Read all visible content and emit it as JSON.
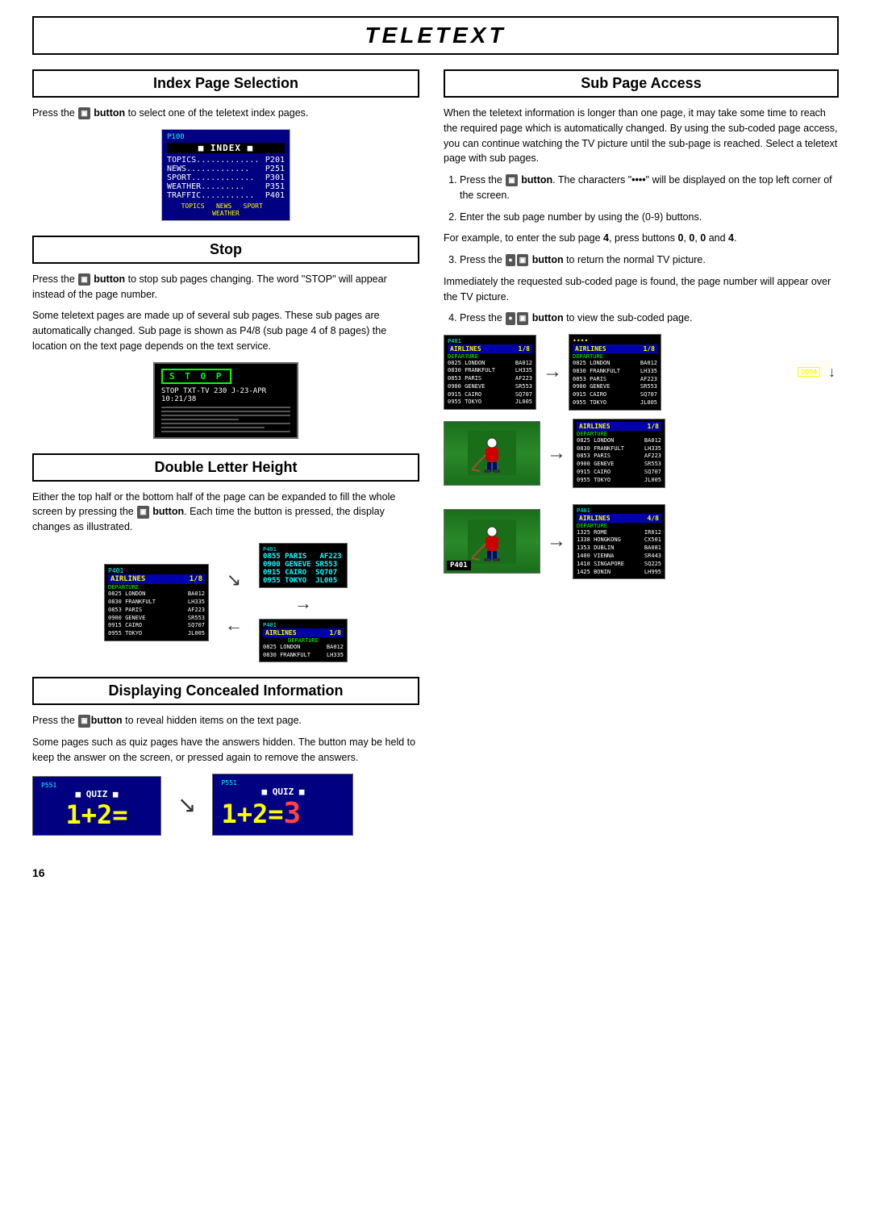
{
  "page": {
    "title": "TELETEXT",
    "footer_number": "16"
  },
  "index_section": {
    "heading": "Index Page Selection",
    "body": "Press the  button to select one of the teletext index pages.",
    "teletext_screen": {
      "page": "P100",
      "title": "■ INDEX ■",
      "rows": [
        {
          "label": "TOPICS.............",
          "value": "P201"
        },
        {
          "label": "NEWS.............",
          "value": "P251"
        },
        {
          "label": "SPORT.............",
          "value": "P301"
        },
        {
          "label": "WEATHER.......",
          "value": "P351"
        },
        {
          "label": "TRAFFIC...........",
          "value": "P401"
        }
      ],
      "nav": "TOPICS  NEWS  SPORT  WEATHER"
    }
  },
  "stop_section": {
    "heading": "Stop",
    "body1": "Press the  button to stop sub pages changing. The word \"STOP\" will appear instead of the page number.",
    "body2": "Some teletext pages are made up of several sub pages. These sub pages are automatically changed. Sub page is shown as P4/8 (sub page 4 of 8 pages) the location on the text page depends on the text service.",
    "screen": {
      "badge": "S T O P",
      "info": "STOP TXT-TV 230 J-23-APR 10:21/38"
    }
  },
  "double_letter_section": {
    "heading": "Double Letter Height",
    "body": "Either the top half or the bottom half of the page can be expanded to fill the whole screen by pressing the  button. Each time the button is pressed, the display changes as illustrated.",
    "screen_page": "P401",
    "airlines_label": "AIRLINES",
    "fraction": "1/8",
    "departure_rows": [
      {
        "time": "0825",
        "dest": "LONDON",
        "code": "BA012"
      },
      {
        "time": "0830",
        "dest": "FRANKFULT",
        "code": "LH335"
      },
      {
        "time": "0853",
        "dest": "PARIS",
        "code": "AF223"
      },
      {
        "time": "0900",
        "dest": "GENEVE",
        "code": "SR553"
      },
      {
        "time": "0915",
        "dest": "CAIRO",
        "code": "SQ707"
      },
      {
        "time": "0955",
        "dest": "TOKYO",
        "code": "JL005"
      }
    ],
    "departure_rows_sm": [
      {
        "time": "0855",
        "dest": "PARIS",
        "code": "AF223"
      },
      {
        "time": "0900",
        "dest": "GENEVE",
        "code": "SR553"
      },
      {
        "time": "0915",
        "dest": "CAIRO",
        "code": "SQ707"
      },
      {
        "time": "0955",
        "dest": "TOKYO",
        "code": "JL005"
      }
    ],
    "departure_rows_sm2": [
      {
        "time": "0825",
        "dest": "LONDON",
        "code": "BA012"
      },
      {
        "time": "0830",
        "dest": "FRANKFULT",
        "code": "LH335"
      }
    ]
  },
  "concealed_section": {
    "heading": "Displaying Concealed Information",
    "body1": "Press the  button to reveal hidden items on the text page.",
    "body2": "Some pages such as quiz pages have the answers hidden. The button may be held to keep the answer on the screen, or pressed again to remove the answers.",
    "quiz1": {
      "page": "P551",
      "title": "■ QUIZ ■",
      "equation": "1+2="
    },
    "quiz2": {
      "page": "P551",
      "title": "■ QUIZ ■",
      "equation": "1+2=",
      "answer": "3"
    }
  },
  "sub_page_section": {
    "heading": "Sub Page Access",
    "intro": "When the teletext information is longer than one page, it may take some time to reach the required page which is automatically changed. By using the sub-coded page access, you can continue watching the TV picture until the sub-page is reached. Select a teletext page with sub pages.",
    "steps": [
      {
        "num": "1",
        "text": "Press the  button. The characters \"••••\" will be displayed on the top left corner of the screen."
      },
      {
        "num": "2",
        "text": "Enter the sub page number by using the (0-9) buttons."
      },
      {
        "num": "example",
        "text": "For example, to enter the sub page 4, press buttons 0, 0, 0 and 4."
      },
      {
        "num": "3",
        "text": "Press the  button to return the normal TV picture."
      },
      {
        "num": "note",
        "text": "Immediately the requested sub-coded page is found, the page number will appear over the TV picture."
      },
      {
        "num": "4",
        "text": "Press the  button to view the sub-coded page."
      }
    ],
    "screen1_page": "P401",
    "screen1_fraction": "1/8",
    "screen2_dots": "••••",
    "screen2_fraction": "1/8",
    "sub_num": "0004",
    "screen3_fraction": "1/8",
    "screen4_page": "P401",
    "screen5_page": "P401",
    "screen5_fraction": "4/8"
  },
  "icons": {
    "button_gray": "▣",
    "arrow_right": "→",
    "arrow_down_right": "↘",
    "arrow_left": "←"
  }
}
